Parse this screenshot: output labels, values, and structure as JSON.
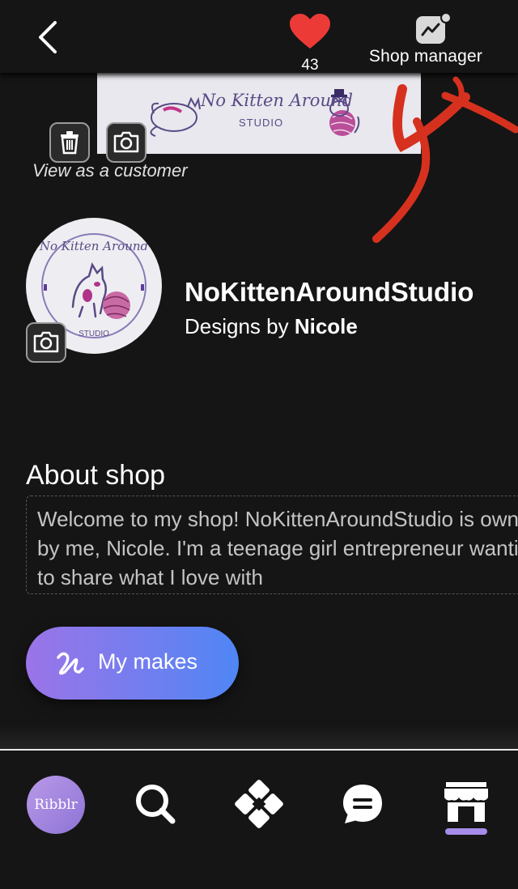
{
  "header": {
    "favorites_count": "43",
    "shop_manager_label": "Shop manager"
  },
  "banner": {
    "logo_title": "No Kitten Around",
    "logo_subtitle": "STUDIO"
  },
  "view_as_customer": "View as a customer",
  "profile": {
    "avatar_text_top": "No Kitten Around",
    "avatar_text_bottom": "STUDIO",
    "shop_name": "NoKittenAroundStudio",
    "designer_prefix": "Designs by ",
    "designer_name": "Nicole"
  },
  "about": {
    "heading": "About shop",
    "text": "Welcome to my shop! NoKittenAroundStudio is owned by me, Nicole. I'm a teenage girl entrepreneur wanting to share what I love with"
  },
  "makes_button_label": "My makes",
  "bottom_nav": {
    "logo_text": "Ribblr",
    "active_item": "shop"
  },
  "colors": {
    "background": "#151515",
    "heart": "#ec3b37",
    "accent_purple": "#a58ce8",
    "annotation_red": "#d6311f"
  }
}
